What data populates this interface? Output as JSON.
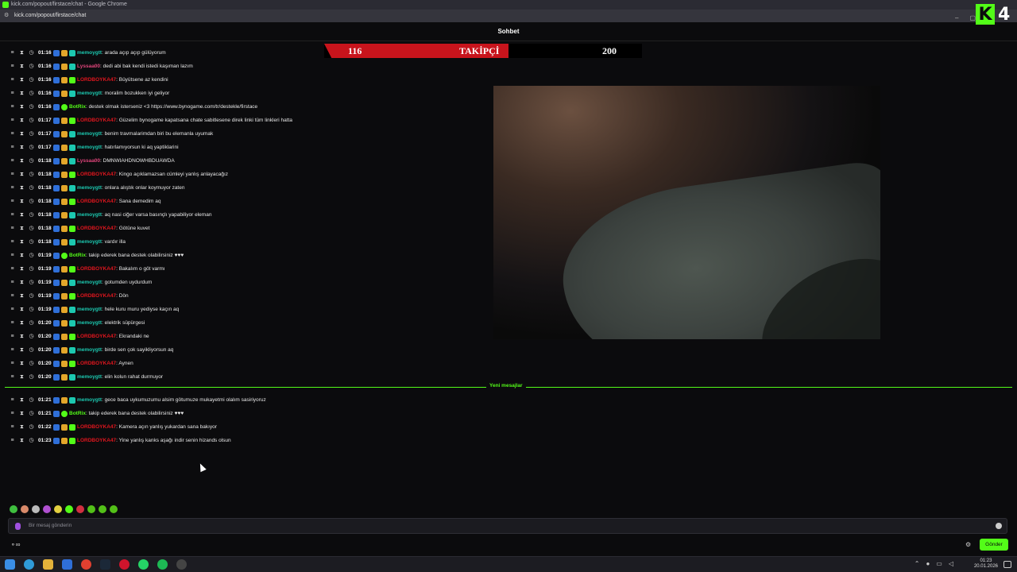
{
  "browser": {
    "window_title": "kick.com/popout/firstace/chat - Google Chrome",
    "url": "kick.com/popout/firstace/chat"
  },
  "chat_header": "Sohbet",
  "follower_goal": {
    "current": "116",
    "label": "TAKİPÇİ",
    "goal": "200",
    "progress": 0.58
  },
  "messages": [
    {
      "time": "01:16",
      "user": "memoygtt",
      "color": "#1cc8b0",
      "badges": [
        "blue",
        "gold",
        "teal"
      ],
      "text": ": arada açıp açıp gülüyorum"
    },
    {
      "time": "01:16",
      "user": "Lyssaa00",
      "color": "#e0457b",
      "badges": [
        "blue",
        "gold",
        "teal"
      ],
      "text": ": dedi abi bak kendi istedi kaşıman lazım"
    },
    {
      "time": "01:16",
      "user": "LORDBOYKA47",
      "color": "#e0161e",
      "badges": [
        "blue",
        "gold",
        "green"
      ],
      "text": ": Büyütsene az kendini"
    },
    {
      "time": "01:16",
      "user": "memoygtt",
      "color": "#1cc8b0",
      "badges": [
        "blue",
        "gold",
        "teal"
      ],
      "text": ": moralim bozukken iyi geliyor"
    },
    {
      "time": "01:16",
      "user": "BotRix",
      "color": "#53fc18",
      "badges": [
        "blue",
        "bot"
      ],
      "text": ": destek olmak isterseniz <3 https://www.bynogame.com/tr/destekle/firstace"
    },
    {
      "time": "01:17",
      "user": "LORDBOYKA47",
      "color": "#e0161e",
      "badges": [
        "blue",
        "gold",
        "green"
      ],
      "text": ": Güzelim bynogame kapatsana chate sabitlesene direk linki tüm linkleri hatta"
    },
    {
      "time": "01:17",
      "user": "memoygtt",
      "color": "#1cc8b0",
      "badges": [
        "blue",
        "gold",
        "teal"
      ],
      "text": ": benim travmalarimdan biri bu elemanla uyumak"
    },
    {
      "time": "01:17",
      "user": "memoygtt",
      "color": "#1cc8b0",
      "badges": [
        "blue",
        "gold",
        "teal"
      ],
      "text": ": hatırlamıyorsun ki aq yaptiklarini"
    },
    {
      "time": "01:18",
      "user": "Lyssaa00",
      "color": "#e0457b",
      "badges": [
        "blue",
        "gold",
        "teal"
      ],
      "text": ": DMNWIAHDNOWHBDUAWDA"
    },
    {
      "time": "01:18",
      "user": "LORDBOYKA47",
      "color": "#e0161e",
      "badges": [
        "blue",
        "gold",
        "green"
      ],
      "text": ": Kingo açıklamazsan cümleyi yanlış anlayacağız"
    },
    {
      "time": "01:18",
      "user": "memoygtt",
      "color": "#1cc8b0",
      "badges": [
        "blue",
        "gold",
        "teal"
      ],
      "text": ": onlara alıştık onlar koymuyor zaten"
    },
    {
      "time": "01:18",
      "user": "LORDBOYKA47",
      "color": "#e0161e",
      "badges": [
        "blue",
        "gold",
        "green"
      ],
      "text": ": Sana demedim aq"
    },
    {
      "time": "01:18",
      "user": "memoygtt",
      "color": "#1cc8b0",
      "badges": [
        "blue",
        "gold",
        "teal"
      ],
      "text": ": aq nasi ciğer varsa basınçlı yapabiliyor eleman"
    },
    {
      "time": "01:18",
      "user": "LORDBOYKA47",
      "color": "#e0161e",
      "badges": [
        "blue",
        "gold",
        "green"
      ],
      "text": ": Götüne kuvet"
    },
    {
      "time": "01:18",
      "user": "memoygtt",
      "color": "#1cc8b0",
      "badges": [
        "blue",
        "gold",
        "teal"
      ],
      "text": ": vardır illa"
    },
    {
      "time": "01:19",
      "user": "BotRix",
      "color": "#53fc18",
      "badges": [
        "blue",
        "bot"
      ],
      "text": ": takip ederek bana destek olabilirsiniz ♥♥♥"
    },
    {
      "time": "01:19",
      "user": "LORDBOYKA47",
      "color": "#e0161e",
      "badges": [
        "blue",
        "gold",
        "green"
      ],
      "text": ": Bakalım o göt varmı"
    },
    {
      "time": "01:19",
      "user": "memoygtt",
      "color": "#1cc8b0",
      "badges": [
        "blue",
        "gold",
        "teal"
      ],
      "text": ": gotumden uydurdum"
    },
    {
      "time": "01:19",
      "user": "LORDBOYKA47",
      "color": "#e0161e",
      "badges": [
        "blue",
        "gold",
        "green"
      ],
      "text": ": Dön"
    },
    {
      "time": "01:19",
      "user": "memoygtt",
      "color": "#1cc8b0",
      "badges": [
        "blue",
        "gold",
        "teal"
      ],
      "text": ": hele kuru muru yediyse kaçın aq"
    },
    {
      "time": "01:20",
      "user": "memoygtt",
      "color": "#1cc8b0",
      "badges": [
        "blue",
        "gold",
        "teal"
      ],
      "text": ": elektrik süpürgesi"
    },
    {
      "time": "01:20",
      "user": "LORDBOYKA47",
      "color": "#e0161e",
      "badges": [
        "blue",
        "gold",
        "green"
      ],
      "text": ": Ekrandaki ne"
    },
    {
      "time": "01:20",
      "user": "memoygtt",
      "color": "#1cc8b0",
      "badges": [
        "blue",
        "gold",
        "teal"
      ],
      "text": ": birde sen çok sayikliyorsun aq"
    },
    {
      "time": "01:20",
      "user": "LORDBOYKA47",
      "color": "#e0161e",
      "badges": [
        "blue",
        "gold",
        "green"
      ],
      "text": ": Aynen"
    },
    {
      "time": "01:20",
      "user": "memoygtt",
      "color": "#1cc8b0",
      "badges": [
        "blue",
        "gold",
        "teal"
      ],
      "text": ": elin kolun rahat durmuyor"
    }
  ],
  "new_messages_label": "Yeni mesajlar",
  "new_messages": [
    {
      "time": "01:21",
      "user": "memoygtt",
      "color": "#1cc8b0",
      "badges": [
        "blue",
        "gold",
        "teal"
      ],
      "text": ": gece baca uykumuzumu alsim götumuze mukayetmi olalım sasiriyoruz"
    },
    {
      "time": "01:21",
      "user": "BotRix",
      "color": "#53fc18",
      "badges": [
        "blue",
        "bot"
      ],
      "text": ": takip ederek bana destek olabilirsiniz ♥♥♥"
    },
    {
      "time": "01:22",
      "user": "LORDBOYKA47",
      "color": "#e0161e",
      "badges": [
        "blue",
        "gold",
        "green"
      ],
      "text": ": Kamera açın yanlış yukardan sana bakıyor"
    },
    {
      "time": "01:23",
      "user": "LORDBOYKA47",
      "color": "#e0161e",
      "badges": [
        "blue",
        "gold",
        "green"
      ],
      "text": ": Yine yanlış kanks aşağı indir senin hizands olsun"
    }
  ],
  "input_placeholder": "Bir mesaj gönderin",
  "send_label": "Gönder",
  "kick_logo_number": "4",
  "clock": {
    "time": "01:23",
    "date": "20.01.2026"
  },
  "colors": {
    "accent": "#53fc18",
    "follow_bar": "#c8141c"
  }
}
